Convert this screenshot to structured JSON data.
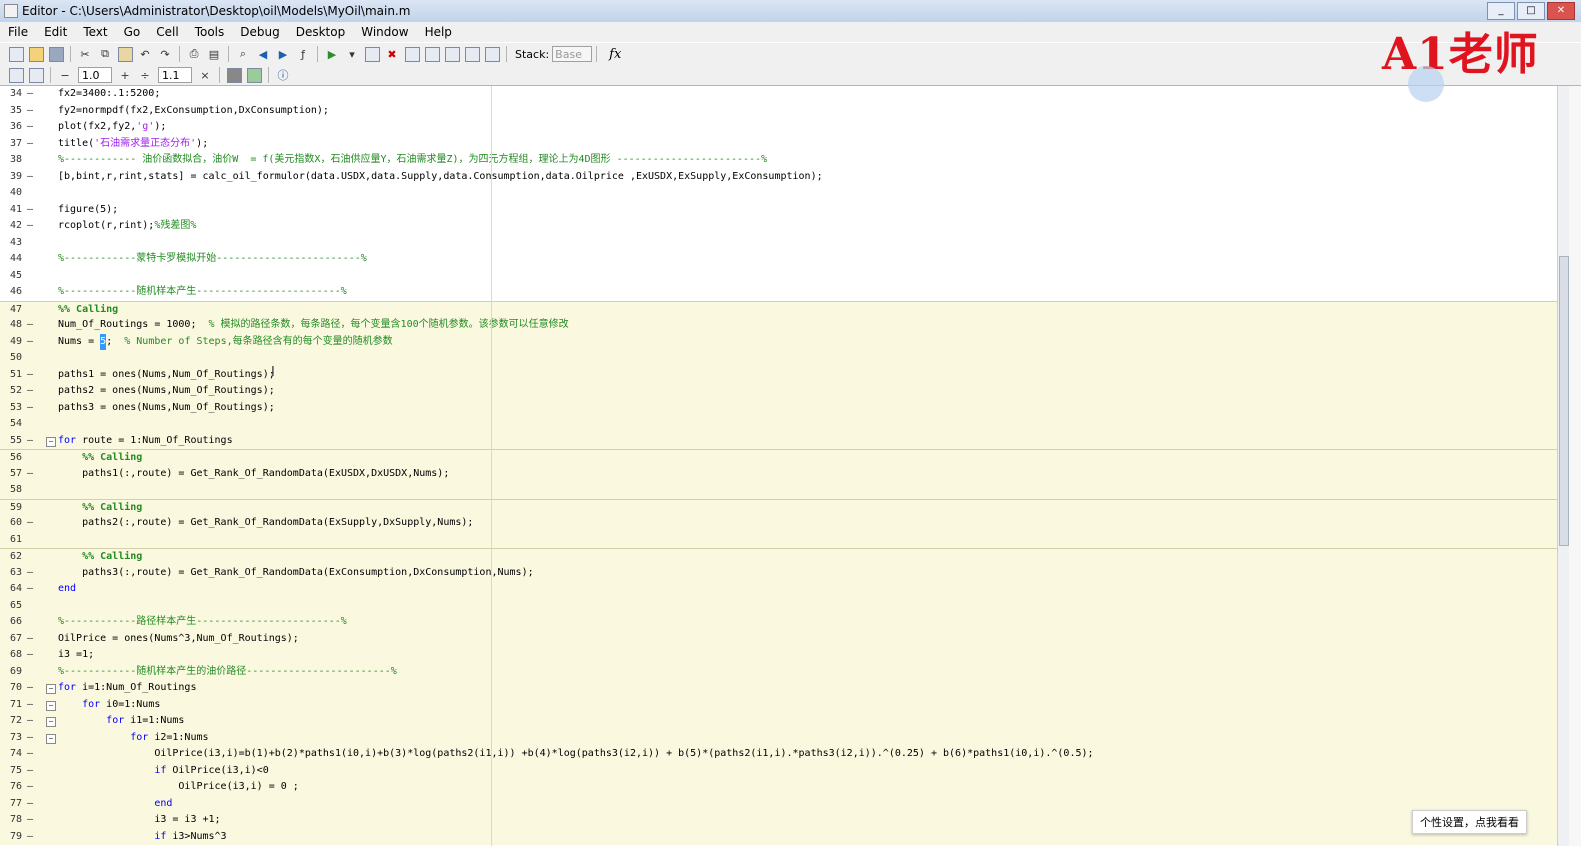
{
  "window": {
    "title": "Editor - C:\\Users\\Administrator\\Desktop\\oil\\Models\\MyOil\\main.m"
  },
  "menu": [
    "File",
    "Edit",
    "Text",
    "Go",
    "Cell",
    "Tools",
    "Debug",
    "Desktop",
    "Window",
    "Help"
  ],
  "toolbar": {
    "stack_label": "Stack:",
    "stack_value": "Base",
    "fx_label": "fx"
  },
  "cell_toolbar": {
    "minus": "−",
    "value1": "1.0",
    "plus": "+",
    "divide": "÷",
    "value2": "1.1",
    "times": "×"
  },
  "watermark": {
    "text": "A1老师"
  },
  "tooltip": {
    "text": "个性设置，点我看看"
  },
  "code_lines": [
    {
      "n": "34",
      "dash": "–",
      "t": "fx2=3400:.1:5200;",
      "k": "p",
      "cell": false
    },
    {
      "n": "35",
      "dash": "–",
      "t": "fy2=normpdf(fx2,ExConsumption,DxConsumption);",
      "k": "p",
      "cell": false
    },
    {
      "n": "36",
      "dash": "–",
      "t": "plot(fx2,fy2,'g');",
      "k": "p",
      "cell": false
    },
    {
      "n": "37",
      "dash": "–",
      "t": "title('石油需求量正态分布');",
      "k": "p",
      "cell": false
    },
    {
      "n": "38",
      "dash": "",
      "t": "%------------ 油价函数拟合，油价W  = f(美元指数X，石油供应量Y，石油需求量Z)，为四元方程组，理论上为4D图形 ------------------------%",
      "k": "c",
      "cell": false
    },
    {
      "n": "39",
      "dash": "–",
      "t": "[b,bint,r,rint,stats] = calc_oil_formulor(data.USDX,data.Supply,data.Consumption,data.Oilprice ,ExUSDX,ExSupply,ExConsumption);",
      "k": "p",
      "cell": false
    },
    {
      "n": "40",
      "dash": "",
      "t": "",
      "k": "p",
      "cell": false
    },
    {
      "n": "41",
      "dash": "–",
      "t": "figure(5);",
      "k": "p",
      "cell": false
    },
    {
      "n": "42",
      "dash": "–",
      "t": "rcoplot(r,rint);%残差图%",
      "k": "p",
      "cell": false
    },
    {
      "n": "43",
      "dash": "",
      "t": "",
      "k": "p",
      "cell": false
    },
    {
      "n": "44",
      "dash": "",
      "t": "%------------蒙特卡罗模拟开始------------------------%",
      "k": "c",
      "cell": false
    },
    {
      "n": "45",
      "dash": "",
      "t": "",
      "k": "p",
      "cell": false
    },
    {
      "n": "46",
      "dash": "",
      "t": "%------------随机样本产生------------------------%",
      "k": "c",
      "cell": false
    },
    {
      "n": "47",
      "dash": "",
      "t": "%% Calling",
      "k": "h",
      "cell": true,
      "border": true
    },
    {
      "n": "48",
      "dash": "–",
      "t": "Num_Of_Routings = 1000;  % 模拟的路径条数，每条路径，每个变量含100个随机参数。该参数可以任意修改",
      "k": "p",
      "cell": true
    },
    {
      "n": "49",
      "dash": "–",
      "t": "Nums = 5;  % Number of Steps,每条路径含有的每个变量的随机参数",
      "k": "p",
      "cell": true
    },
    {
      "n": "50",
      "dash": "",
      "t": "",
      "k": "p",
      "cell": true
    },
    {
      "n": "51",
      "dash": "–",
      "t": "paths1 = ones(Nums,Num_Of_Routings);",
      "k": "p",
      "cell": true
    },
    {
      "n": "52",
      "dash": "–",
      "t": "paths2 = ones(Nums,Num_Of_Routings);",
      "k": "p",
      "cell": true
    },
    {
      "n": "53",
      "dash": "–",
      "t": "paths3 = ones(Nums,Num_Of_Routings);",
      "k": "p",
      "cell": true
    },
    {
      "n": "54",
      "dash": "",
      "t": "",
      "k": "p",
      "cell": true
    },
    {
      "n": "55",
      "dash": "–",
      "t": "for route = 1:Num_Of_Routings",
      "k": "p",
      "cell": true,
      "fold": "−"
    },
    {
      "n": "56",
      "dash": "",
      "t": "    %% Calling",
      "k": "h",
      "cell": true,
      "border": true
    },
    {
      "n": "57",
      "dash": "–",
      "t": "    paths1(:,route) = Get_Rank_Of_RandomData(ExUSDX,DxUSDX,Nums);",
      "k": "p",
      "cell": true
    },
    {
      "n": "58",
      "dash": "",
      "t": "",
      "k": "p",
      "cell": true
    },
    {
      "n": "59",
      "dash": "",
      "t": "    %% Calling",
      "k": "h",
      "cell": true,
      "border": true
    },
    {
      "n": "60",
      "dash": "–",
      "t": "    paths2(:,route) = Get_Rank_Of_RandomData(ExSupply,DxSupply,Nums);",
      "k": "p",
      "cell": true
    },
    {
      "n": "61",
      "dash": "",
      "t": "",
      "k": "p",
      "cell": true
    },
    {
      "n": "62",
      "dash": "",
      "t": "    %% Calling",
      "k": "h",
      "cell": true,
      "border": true
    },
    {
      "n": "63",
      "dash": "–",
      "t": "    paths3(:,route) = Get_Rank_Of_RandomData(ExConsumption,DxConsumption,Nums);",
      "k": "p",
      "cell": true
    },
    {
      "n": "64",
      "dash": "–",
      "t": "end",
      "k": "p",
      "cell": true
    },
    {
      "n": "65",
      "dash": "",
      "t": "",
      "k": "p",
      "cell": true
    },
    {
      "n": "66",
      "dash": "",
      "t": "%------------路径样本产生------------------------%",
      "k": "c",
      "cell": true
    },
    {
      "n": "67",
      "dash": "–",
      "t": "OilPrice = ones(Nums^3,Num_Of_Routings);",
      "k": "p",
      "cell": true
    },
    {
      "n": "68",
      "dash": "–",
      "t": "i3 =1;",
      "k": "p",
      "cell": true
    },
    {
      "n": "69",
      "dash": "",
      "t": "%------------随机样本产生的油价路径------------------------%",
      "k": "c",
      "cell": true
    },
    {
      "n": "70",
      "dash": "–",
      "t": "for i=1:Num_Of_Routings",
      "k": "p",
      "cell": true,
      "fold": "−"
    },
    {
      "n": "71",
      "dash": "–",
      "t": "    for i0=1:Nums",
      "k": "p",
      "cell": true,
      "fold": "−"
    },
    {
      "n": "72",
      "dash": "–",
      "t": "        for i1=1:Nums",
      "k": "p",
      "cell": true,
      "fold": "−"
    },
    {
      "n": "73",
      "dash": "–",
      "t": "            for i2=1:Nums",
      "k": "p",
      "cell": true,
      "fold": "−"
    },
    {
      "n": "74",
      "dash": "–",
      "t": "                OilPrice(i3,i)=b(1)+b(2)*paths1(i0,i)+b(3)*log(paths2(i1,i)) +b(4)*log(paths3(i2,i)) + b(5)*(paths2(i1,i).*paths3(i2,i)).^(0.25) + b(6)*paths1(i0,i).^(0.5);",
      "k": "p",
      "cell": true
    },
    {
      "n": "75",
      "dash": "–",
      "t": "                if OilPrice(i3,i)<0",
      "k": "p",
      "cell": true
    },
    {
      "n": "76",
      "dash": "–",
      "t": "                    OilPrice(i3,i) = 0 ;",
      "k": "p",
      "cell": true
    },
    {
      "n": "77",
      "dash": "–",
      "t": "                end",
      "k": "p",
      "cell": true
    },
    {
      "n": "78",
      "dash": "–",
      "t": "                i3 = i3 +1;",
      "k": "p",
      "cell": true
    },
    {
      "n": "79",
      "dash": "–",
      "t": "                if i3>Nums^3",
      "k": "p",
      "cell": true
    }
  ]
}
